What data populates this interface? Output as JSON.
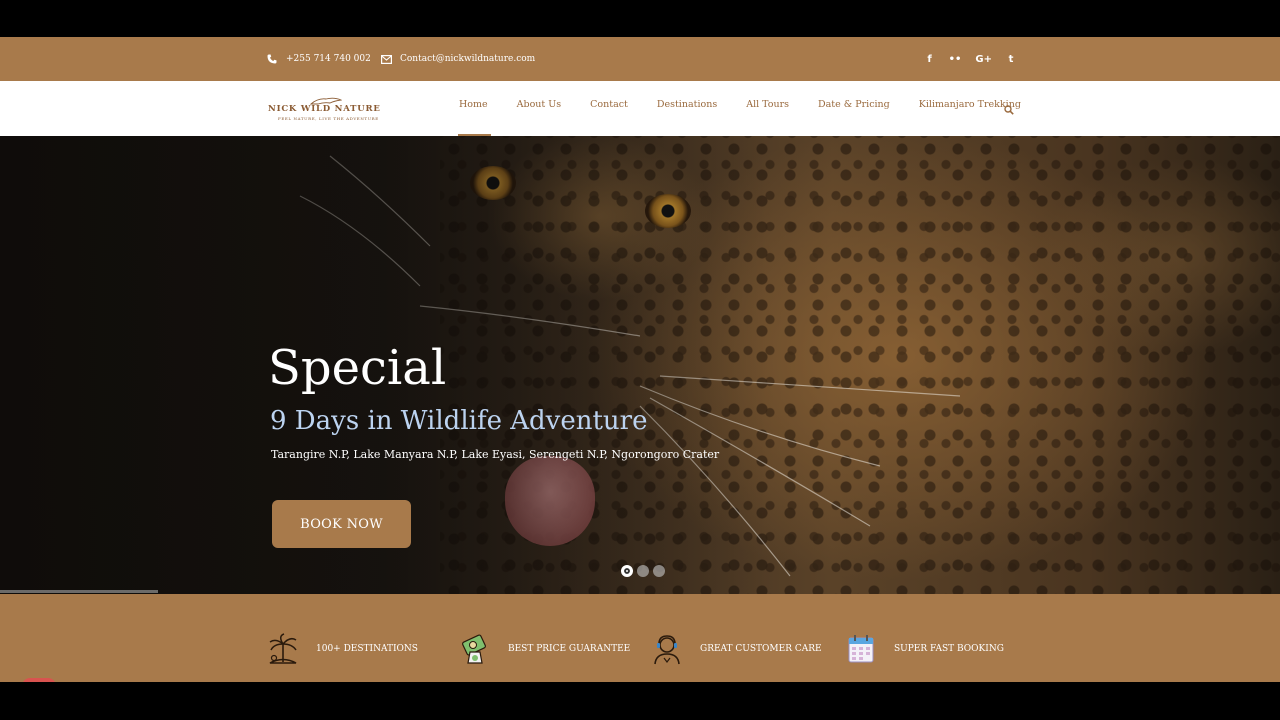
{
  "topbar": {
    "phone": "+255 714 740 002",
    "email": "Contact@nickwildnature.com",
    "social_icons": [
      "facebook-icon",
      "flickr-icon",
      "google-plus-icon",
      "twitter-icon"
    ],
    "social_glyphs": [
      "f",
      "••",
      "G+",
      "t"
    ]
  },
  "logo": {
    "name": "NICK WILD NATURE",
    "tagline": "FEEL NATURE, LIVE THE ADVENTURE"
  },
  "nav": {
    "items": [
      "Home",
      "About Us",
      "Contact",
      "Destinations",
      "All Tours",
      "Date & Pricing",
      "Kilimanjaro Trekking"
    ],
    "active": "Home"
  },
  "hero": {
    "title": "Special",
    "subtitle": "9 Days in Wildlife Adventure",
    "places": "Tarangire N.P, Lake Manyara N.P, Lake Eyasi, Serengeti N.P, Ngorongoro Crater",
    "button": "BOOK NOW",
    "slide_count": 3,
    "active_slide": 1
  },
  "features": [
    {
      "label": "100+ DESTINATIONS",
      "icon": "palm-island-icon"
    },
    {
      "label": "BEST PRICE GUARANTEE",
      "icon": "price-tag-icon"
    },
    {
      "label": "GREAT CUSTOMER CARE",
      "icon": "customer-support-icon"
    },
    {
      "label": "SUPER FAST BOOKING",
      "icon": "calendar-icon"
    }
  ],
  "colors": {
    "brand": "#a87a4b",
    "nav_text": "#9a6a3e",
    "subtitle": "#bcd3f0"
  }
}
